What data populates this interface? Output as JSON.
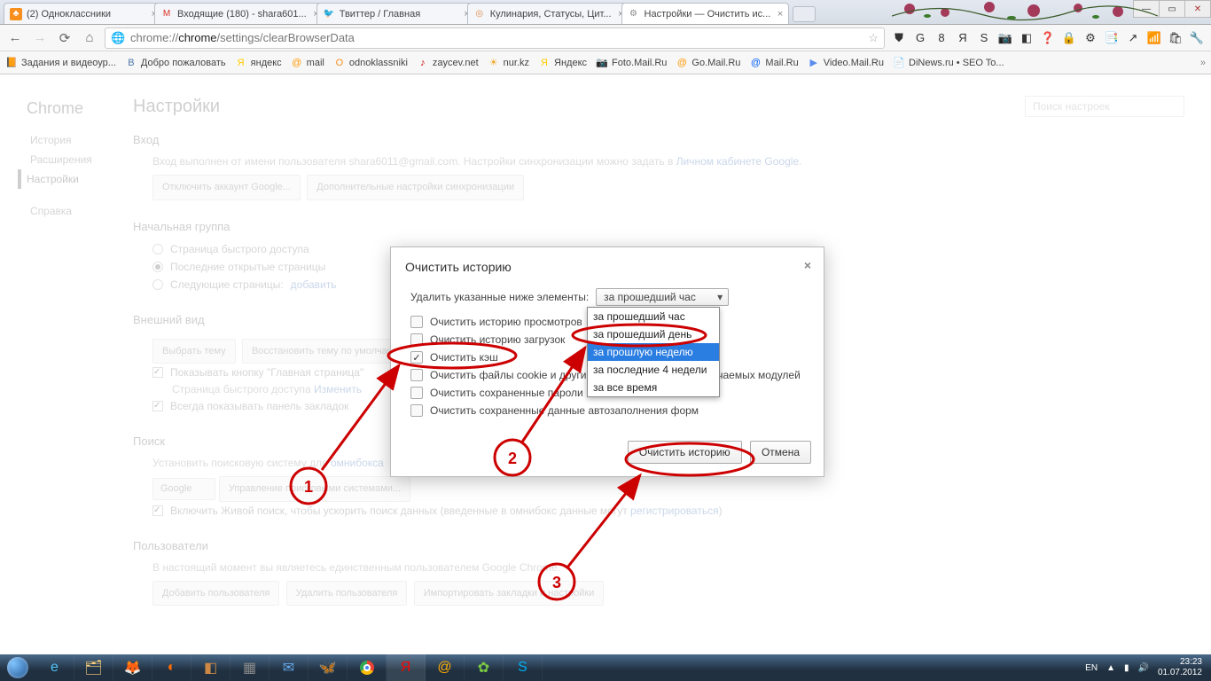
{
  "tabs": [
    {
      "title": "(2) Одноклассники",
      "favicon_color": "#f78f1e"
    },
    {
      "title": "Входящие (180) - shara601...",
      "favicon_color": "#d93025"
    },
    {
      "title": "Твиттер / Главная",
      "favicon_color": "#1da1f2"
    },
    {
      "title": "Кулинария, Статусы, Цит...",
      "favicon_color": "#e08f4f"
    },
    {
      "title": "Настройки — Очистить ис...",
      "favicon_color": "#888",
      "active": true
    }
  ],
  "url": {
    "dim_prefix": "chrome://",
    "dark": "chrome",
    "dim_suffix": "/settings/clearBrowserData"
  },
  "ext_icons": [
    "⛊",
    "G",
    "8",
    "Я",
    "S",
    "📷",
    "◧",
    "❓",
    "🔒",
    "⚙",
    "📑",
    "↗",
    "📶",
    "🛍",
    "🔧"
  ],
  "bookmarks": [
    {
      "label": "Задания и видеоур...",
      "icon": "📙",
      "color": "#f78f1e"
    },
    {
      "label": "Добро пожаловать",
      "icon": "B",
      "color": "#4a76a8"
    },
    {
      "label": "яндекс",
      "icon": "Я",
      "color": "#ffcc00"
    },
    {
      "label": "mail",
      "icon": "@",
      "color": "#ff9900"
    },
    {
      "label": "odnoklassniki",
      "icon": "O",
      "color": "#f78f1e"
    },
    {
      "label": "zaycev.net",
      "icon": "♪",
      "color": "#cc0000"
    },
    {
      "label": "nur.kz",
      "icon": "☀",
      "color": "#f5a623"
    },
    {
      "label": "Яндекс",
      "icon": "Я",
      "color": "#ffcc00"
    },
    {
      "label": "Foto.Mail.Ru",
      "icon": "📷",
      "color": "#5b8def"
    },
    {
      "label": "Go.Mail.Ru",
      "icon": "@",
      "color": "#ff9900"
    },
    {
      "label": "Mail.Ru",
      "icon": "@",
      "color": "#005ff9"
    },
    {
      "label": "Video.Mail.Ru",
      "icon": "▶",
      "color": "#5b8def"
    },
    {
      "label": "DiNews.ru • SEO To...",
      "icon": "📄",
      "color": "#888"
    }
  ],
  "sidebar": {
    "brand": "Chrome",
    "items": [
      "История",
      "Расширения",
      "Настройки"
    ],
    "help": "Справка",
    "current_index": 2
  },
  "settings": {
    "title": "Настройки",
    "search_placeholder": "Поиск настроек",
    "login": {
      "heading": "Вход",
      "text_prefix": "Вход выполнен от имени пользователя shara6011@gmail.com. Настройки синхронизации можно задать в ",
      "link": "Личном кабинете Google",
      "btn_disconnect": "Отключить аккаунт Google...",
      "btn_sync": "Дополнительные настройки синхронизации"
    },
    "startup": {
      "heading": "Начальная группа",
      "opt1": "Страница быстрого доступа",
      "opt2": "Последние открытые страницы",
      "opt3_a": "Следующие страницы: ",
      "opt3_link": "добавить"
    },
    "appearance": {
      "heading": "Внешний вид",
      "btn_theme": "Выбрать тему",
      "btn_reset": "Восстановить тему по умолчанию",
      "chk_home": "Показывать кнопку \"Главная страница\"",
      "home_text": "Страница быстрого доступа  ",
      "home_link": "Изменить",
      "chk_bookmarks": "Всегда показывать панель закладок"
    },
    "search": {
      "heading": "Поиск",
      "text_a": "Установить поисковую систему для ",
      "text_link": "омнибокса",
      "engine": "Google",
      "btn_manage": "Управление поисковыми системами...",
      "chk_instant_a": "Включить Живой поиск, чтобы ускорить поиск данных (введенные в омнибокс данные могут ",
      "chk_instant_link": "регистрироваться",
      "chk_instant_b": ")"
    },
    "users": {
      "heading": "Пользователи",
      "text": "В настоящий момент вы являетесь единственным пользователем Google Chrome.",
      "btn_add": "Добавить пользователя",
      "btn_del": "Удалить пользователя",
      "btn_import": "Импортировать закладки и настройки"
    }
  },
  "modal": {
    "title": "Очистить историю",
    "delete_label": "Удалить указанные ниже элементы:",
    "select_value": "за прошедший час",
    "options": [
      "за прошедший час",
      "за прошедший день",
      "за прошлую неделю",
      "за последние 4 недели",
      "за все время"
    ],
    "selected_index": 2,
    "checks": [
      {
        "label": "Очистить историю просмотров",
        "checked": false
      },
      {
        "label": "Очистить историю загрузок",
        "checked": false
      },
      {
        "label": "Очистить кэш",
        "checked": true
      },
      {
        "label": "Очистить файлы cookie и другие данные сайтов и подключаемых модулей",
        "checked": false
      },
      {
        "label": "Очистить сохраненные пароли",
        "checked": false
      },
      {
        "label": "Очистить сохраненные данные автозаполнения форм",
        "checked": false
      }
    ],
    "btn_clear": "Очистить историю",
    "btn_cancel": "Отмена"
  },
  "tray": {
    "lang": "EN",
    "time": "23:23",
    "date": "01.07.2012"
  },
  "annotations": {
    "n1": "1",
    "n2": "2",
    "n3": "3"
  }
}
